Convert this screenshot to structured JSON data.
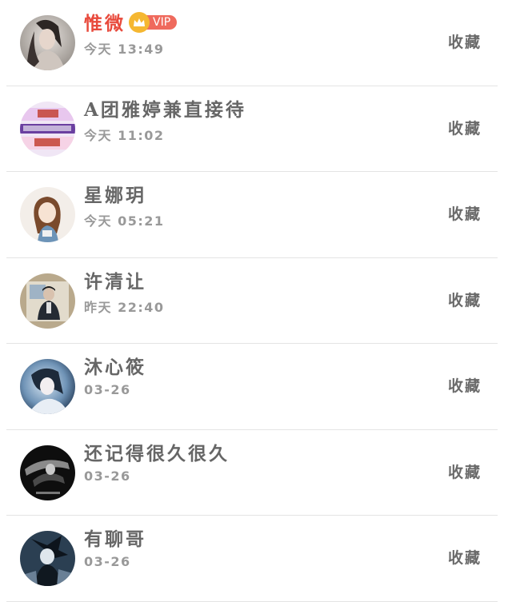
{
  "contacts": [
    {
      "name": "惟微",
      "time": "今天 13:49",
      "action": "收藏",
      "vip": true,
      "vip_label": "VIP",
      "avatar": "woman-portrait-avatar"
    },
    {
      "name": "A团雅婷兼直接待",
      "time": "今天 11:02",
      "action": "收藏",
      "vip": false,
      "avatar": "recruitment-ad-avatar"
    },
    {
      "name": "星娜玥",
      "time": "今天 05:21",
      "action": "收藏",
      "vip": false,
      "avatar": "anime-girl-avatar"
    },
    {
      "name": "许清让",
      "time": "昨天 22:40",
      "action": "收藏",
      "vip": false,
      "avatar": "man-in-suit-avatar"
    },
    {
      "name": "沐心筱",
      "time": "03-26",
      "action": "收藏",
      "vip": false,
      "avatar": "dreamy-girl-avatar"
    },
    {
      "name": "还记得很久很久",
      "time": "03-26",
      "action": "收藏",
      "vip": false,
      "avatar": "dark-figure-avatar"
    },
    {
      "name": "有聊哥",
      "time": "03-26",
      "action": "收藏",
      "vip": false,
      "avatar": "anime-character-avatar"
    }
  ],
  "colors": {
    "vip_name": "#e84a3c",
    "vip_tag": "#ef6a5d",
    "crown": "#f5b731",
    "divider": "#e4e4e4"
  }
}
